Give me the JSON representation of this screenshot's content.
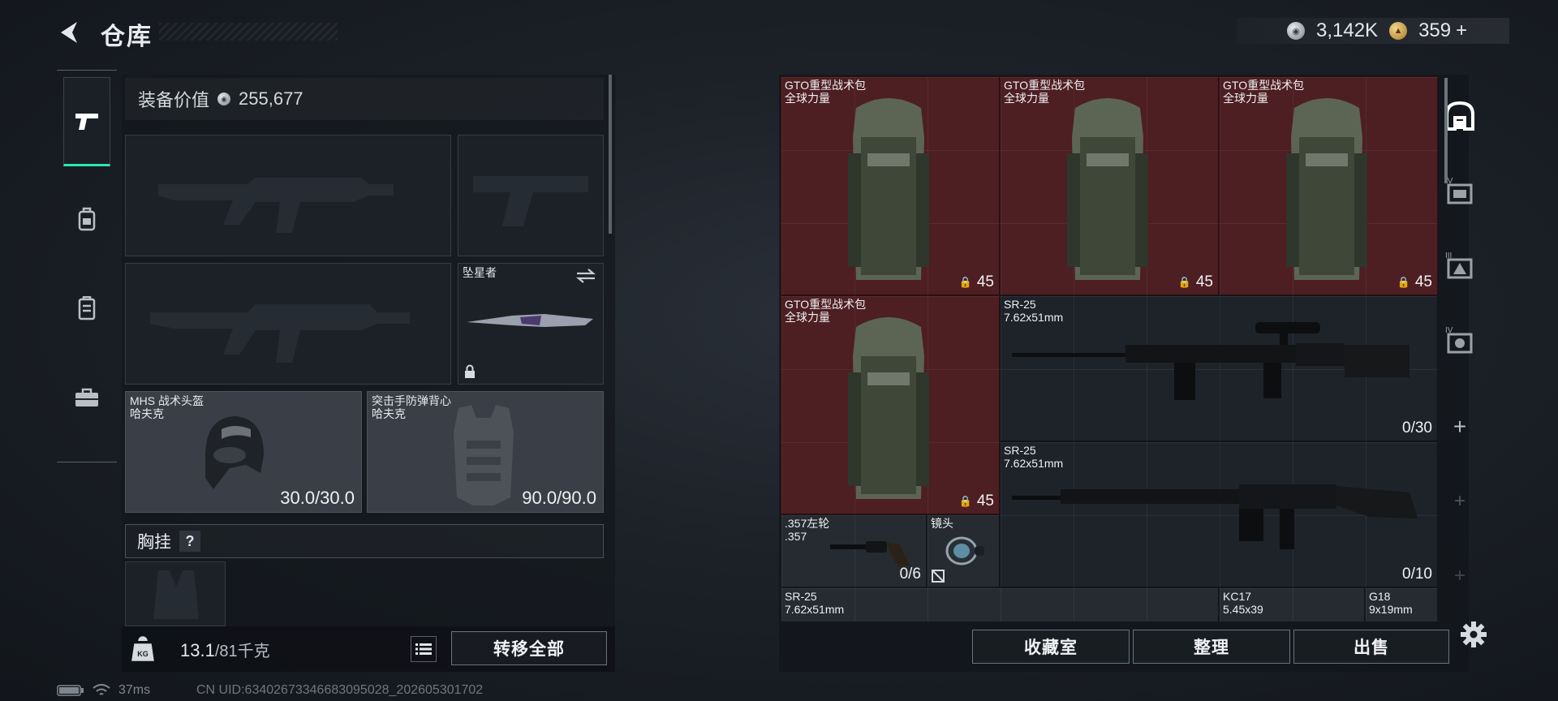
{
  "header": {
    "title": "仓库",
    "currency_silver": "3,142K",
    "currency_gold": "359",
    "add_symbol": "+"
  },
  "left_nav": {
    "items": [
      "pistol-icon",
      "backpack-icon",
      "locker-icon",
      "toolbox-icon"
    ],
    "active_index": 0
  },
  "loadout": {
    "equipment_value_label": "装备价值",
    "equipment_value": "255,677",
    "melee": {
      "name": "坠星者"
    },
    "helmet": {
      "name": "MHS 战术头盔",
      "sub": "哈夫克",
      "durability": "30.0/30.0"
    },
    "armor": {
      "name": "突击手防弹背心",
      "sub": "哈夫克",
      "durability": "90.0/90.0"
    },
    "chest_rig_label": "胸挂",
    "chest_rig_help": "?"
  },
  "bottom": {
    "weight_current": "13.1",
    "weight_max": "/81千克",
    "transfer_all": "转移全部"
  },
  "stash": {
    "items": [
      {
        "name": "GTO重型战术包",
        "sub": "全球力量",
        "count": "45"
      },
      {
        "name": "GTO重型战术包",
        "sub": "全球力量",
        "count": "45"
      },
      {
        "name": "GTO重型战术包",
        "sub": "全球力量",
        "count": "45"
      },
      {
        "name": "GTO重型战术包",
        "sub": "全球力量",
        "count": "45"
      },
      {
        "name": "SR-25",
        "sub": "7.62x51mm",
        "count": "0/30"
      },
      {
        "name": "SR-25",
        "sub": "7.62x51mm",
        "count": "0/10"
      },
      {
        "name": ".357左轮",
        "sub": ".357",
        "count": "0/6"
      },
      {
        "name": "镜头",
        "sub": "",
        "count": ""
      },
      {
        "name": "SR-25",
        "sub": "7.62x51mm",
        "count": ""
      },
      {
        "name": "KC17",
        "sub": "5.45x39",
        "count": ""
      },
      {
        "name": "G18",
        "sub": "9x19mm",
        "count": ""
      }
    ],
    "buttons": {
      "collection": "收藏室",
      "sort": "整理",
      "sell": "出售"
    },
    "side_tabs": [
      "home-icon",
      "tier-iv-stash-icon",
      "tier-iii-stash-icon",
      "tier-iv-gear-stash-icon",
      "add-icon",
      "add-icon",
      "add-icon"
    ]
  },
  "status": {
    "ping": "37ms",
    "uid": "CN UID:6340267334668309502​8_202605301702"
  }
}
